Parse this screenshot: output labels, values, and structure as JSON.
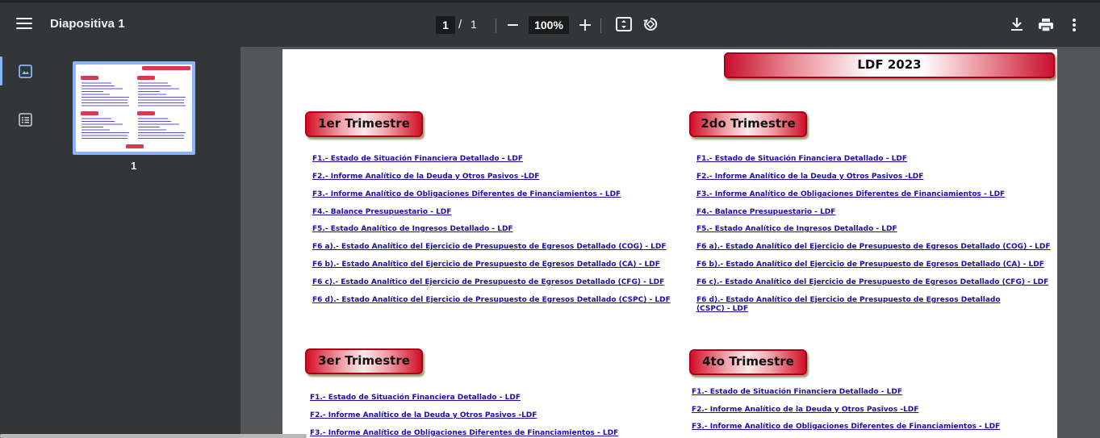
{
  "toolbar": {
    "title": "Diapositiva 1",
    "page_current": "1",
    "page_sep": "/",
    "page_total": "1",
    "zoom": "100%",
    "icons": [
      "menu-icon",
      "zoom-out-icon",
      "zoom-in-icon",
      "fit-page-icon",
      "rotate-icon",
      "download-icon",
      "print-icon",
      "more-vert-icon"
    ]
  },
  "sidebar": {
    "icons": [
      "thumbnails-icon",
      "outline-icon"
    ],
    "thumb_page_number": "1"
  },
  "document": {
    "banner": "LDF 2023",
    "sections": [
      {
        "title": "1er Trimestre",
        "links": [
          "F1.- Estado de Situación Financiera Detallado - LDF",
          "F2.- Informe Analítico de la Deuda y Otros Pasivos -LDF",
          "F3.- Informe Analítico de Obligaciones Diferentes de Financiamientos - LDF",
          "F4.- Balance Presupuestario - LDF",
          "F5.- Estado Analítico de Ingresos Detallado - LDF",
          "F6 a).- Estado Analítico del Ejercicio de Presupuesto de Egresos Detallado (COG) - LDF",
          "F6 b).- Estado Analítico del Ejercicio de Presupuesto de Egresos Detallado (CA) - LDF",
          "F6 c).- Estado Analítico del Ejercicio de Presupuesto de Egresos Detallado (CFG) - LDF",
          "F6 d).- Estado Analítico del Ejercicio de Presupuesto de Egresos Detallado (CSPC) - LDF"
        ]
      },
      {
        "title": "2do Trimestre",
        "links": [
          "F1.- Estado de Situación Financiera Detallado - LDF",
          "F2.- Informe Analítico de la Deuda y Otros Pasivos -LDF",
          "F3.- Informe Analítico de Obligaciones Diferentes de Financiamientos - LDF",
          "F4.- Balance Presupuestario - LDF",
          "F5.- Estado Analítico de Ingresos Detallado - LDF",
          "F6 a).- Estado Analítico del Ejercicio de Presupuesto de Egresos Detallado (COG) - LDF",
          "F6 b).- Estado Analítico del Ejercicio de Presupuesto de Egresos Detallado (CA) - LDF",
          "F6 c).- Estado Analítico del Ejercicio de Presupuesto de Egresos Detallado (CFG) - LDF",
          "F6 d).- Estado Analítico del Ejercicio de Presupuesto de Egresos Detallado (CSPC) - LDF"
        ]
      },
      {
        "title": "3er Trimestre",
        "links": [
          "F1.- Estado de Situación Financiera Detallado - LDF",
          "F2.- Informe Analítico de la Deuda y Otros Pasivos -LDF",
          "F3.- Informe Analítico de Obligaciones Diferentes de Financiamientos - LDF"
        ]
      },
      {
        "title": "4to Trimestre",
        "links": [
          "F1.- Estado de Situación Financiera Detallado - LDF",
          "F2.- Informe Analítico de la Deuda y Otros Pasivos -LDF",
          "F3.- Informe Analítico de Obligaciones Diferentes de Financiamientos - LDF"
        ]
      }
    ]
  }
}
